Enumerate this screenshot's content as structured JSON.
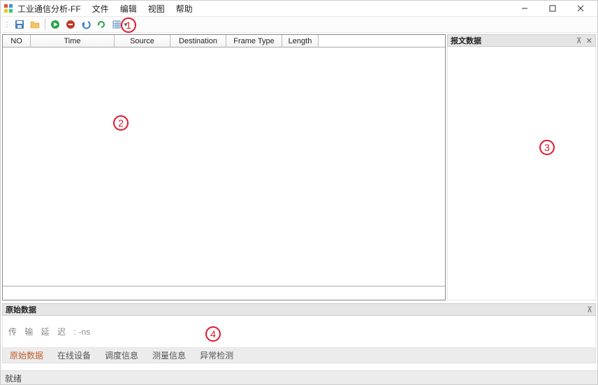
{
  "title": "工业通信分析-FF",
  "menu": [
    "文件",
    "编辑",
    "视图",
    "帮助"
  ],
  "toolbar": {
    "icons": [
      "save-icon",
      "open-icon",
      "play-icon",
      "stop-icon",
      "undo-icon",
      "refresh-icon",
      "grid-icon"
    ]
  },
  "grid": {
    "columns": [
      "NO",
      "Time",
      "Source",
      "Destination",
      "Frame Type",
      "Length"
    ]
  },
  "rightPanel": {
    "title": "报文数据"
  },
  "bottomPanel": {
    "title": "原始数据",
    "delayLabel": "传 输 延 迟 :",
    "delayValue": "-ns",
    "tabs": [
      "原始数据",
      "在线设备",
      "调度信息",
      "测量信息",
      "异常检测"
    ],
    "activeTab": 0
  },
  "status": "就绪",
  "annotations": [
    "1",
    "2",
    "3",
    "4"
  ]
}
